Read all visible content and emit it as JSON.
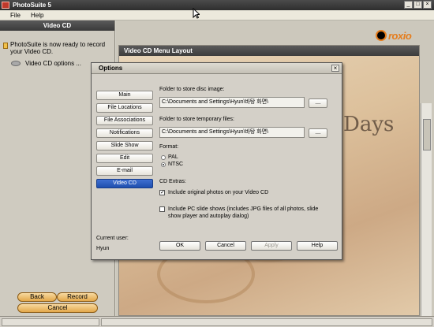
{
  "app": {
    "title": "PhotoSuite 5"
  },
  "window_controls": {
    "minimize": "_",
    "maximize": "□",
    "close": "×"
  },
  "menu": [
    {
      "label": "File"
    },
    {
      "label": "Help"
    }
  ],
  "left_panel": {
    "header": "Video CD",
    "info_text": "PhotoSuite is now ready to record your Video CD.",
    "vcd_options": "Video CD options ...",
    "back": "Back",
    "record": "Record",
    "cancel": "Cancel"
  },
  "logo": {
    "text": "roxio"
  },
  "canvas": {
    "title": "Video CD Menu Layout",
    "overlay_text": "Days"
  },
  "dialog": {
    "title": "Options",
    "close": "×",
    "nav": [
      {
        "label": "Main",
        "active": false
      },
      {
        "label": "File Locations",
        "active": false
      },
      {
        "label": "File Associations",
        "active": false
      },
      {
        "label": "Notifications",
        "active": false
      },
      {
        "label": "Slide Show",
        "active": false
      },
      {
        "label": "Edit",
        "active": false
      },
      {
        "label": "E-mail",
        "active": false
      },
      {
        "label": "Video CD",
        "active": true
      }
    ],
    "disc_image_label": "Folder to store disc image:",
    "disc_image_path": "C:\\Documents and Settings\\Hyun\\바탕 화면\\",
    "temp_label": "Folder to store temporary files:",
    "temp_path": "C:\\Documents and Settings\\Hyun\\바탕 화면\\",
    "browse_label": "...",
    "format_label": "Format:",
    "format_options": [
      {
        "label": "PAL",
        "checked": false
      },
      {
        "label": "NTSC",
        "checked": true
      }
    ],
    "extras_label": "CD Extras:",
    "include_original": {
      "label": "Include original photos on your Video CD",
      "checked": true
    },
    "include_pc": {
      "label": "Include PC slide shows (includes JPG files of all photos, slide show player and autoplay dialog)",
      "checked": false
    },
    "current_user_label": "Current user:",
    "current_user": "Hyun",
    "ok": "OK",
    "cancel": "Cancel",
    "apply": "Apply",
    "help": "Help"
  }
}
